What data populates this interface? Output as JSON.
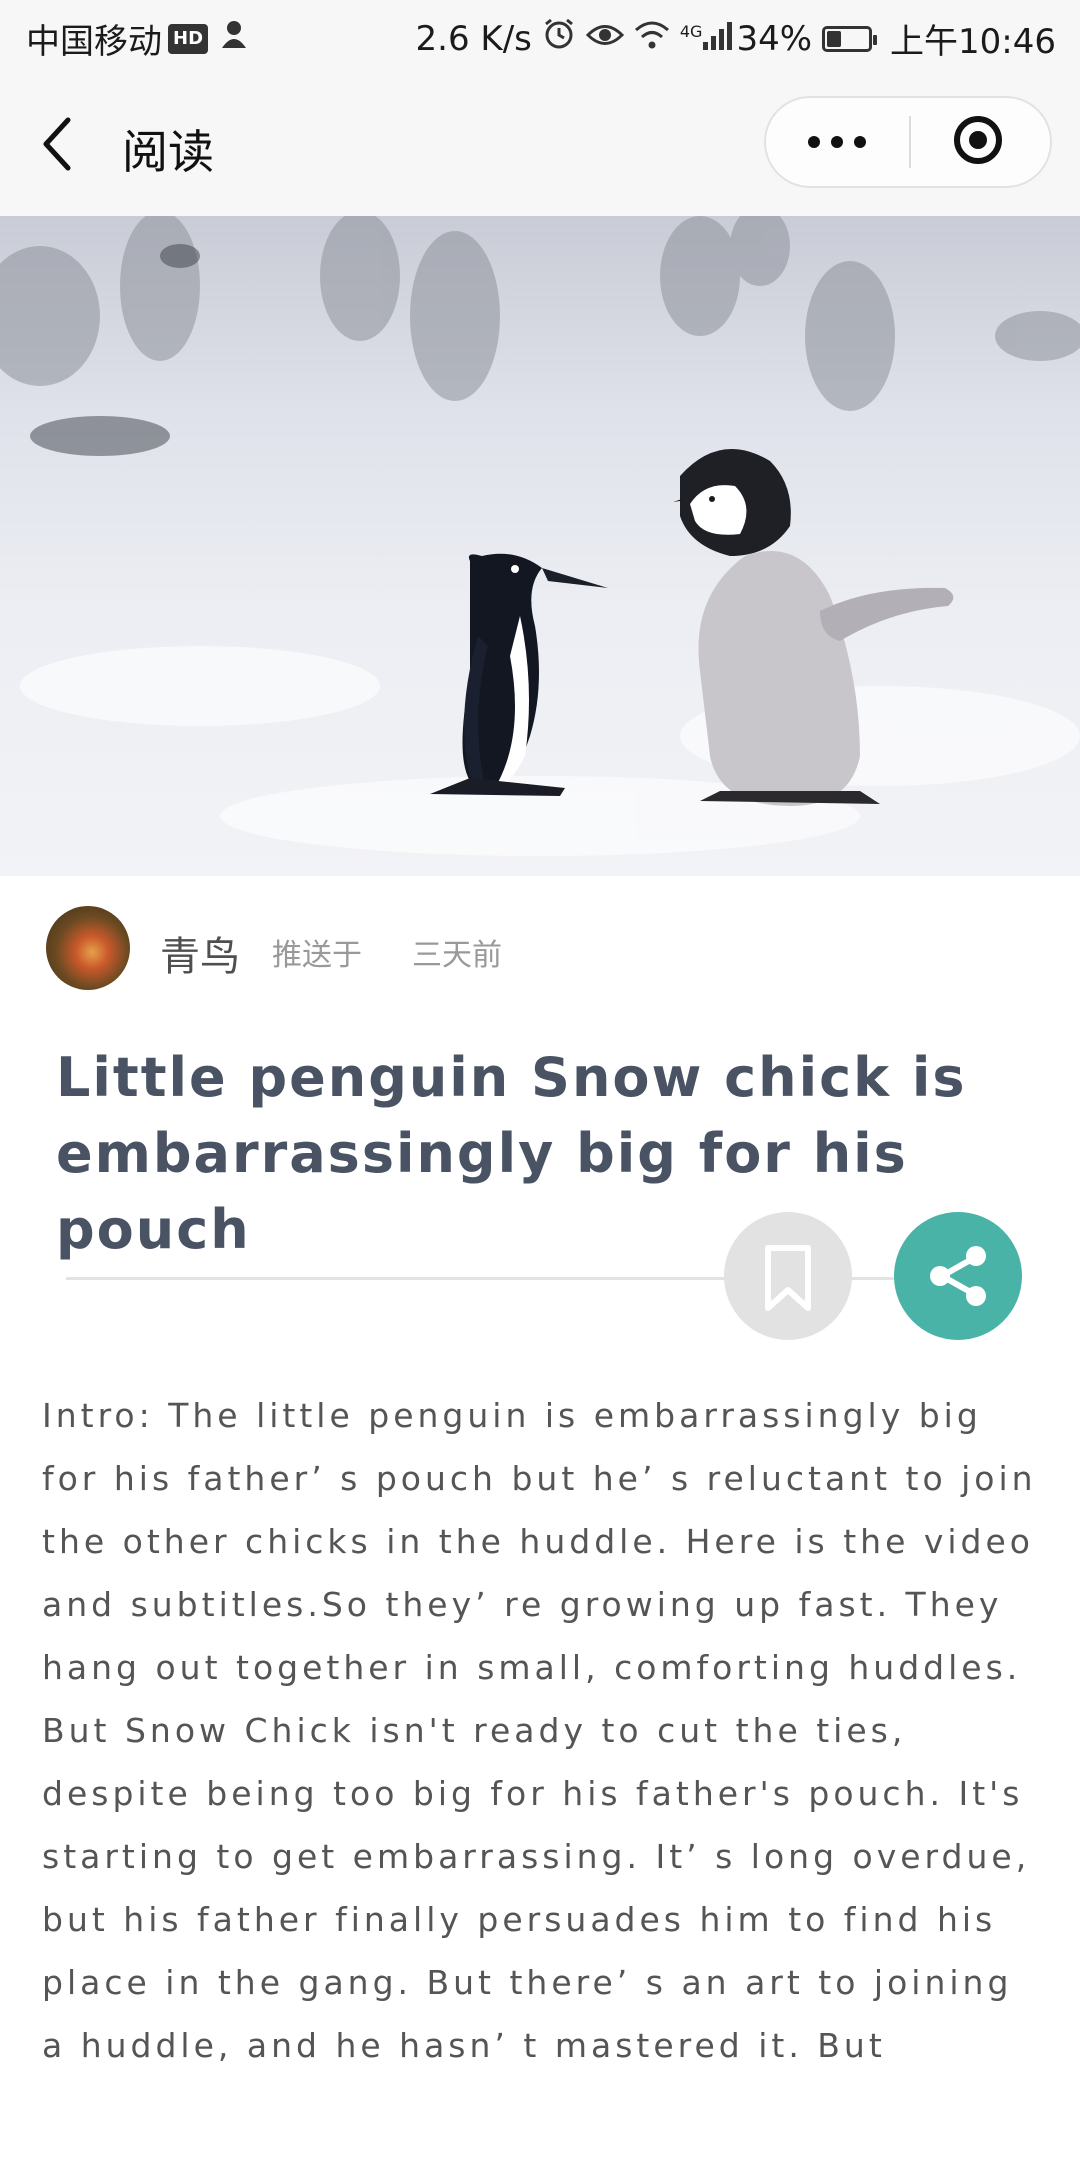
{
  "status_bar": {
    "carrier": "中国移动",
    "hd_badge": "HD",
    "speed": "2.6 K/s",
    "network": "4G",
    "battery": "34%",
    "battery_level": 0.34,
    "time": "上午10:46",
    "icons": [
      "profile-icon",
      "alarm-icon",
      "eye-icon",
      "wifi-icon",
      "signal-icon",
      "battery-icon"
    ]
  },
  "nav": {
    "title": "阅读",
    "icons": [
      "back-arrow-icon",
      "more-dots-icon",
      "close-target-icon"
    ]
  },
  "hero": {
    "icon": "penguins-photo"
  },
  "article": {
    "author": "青鸟",
    "pushed_label": "推送于",
    "time_ago": "三天前",
    "title": "Little penguin Snow chick is embarrassingly big for his pouch",
    "intro": "Intro: The little penguin is embarrassingly big for his father’ s pouch but he’ s reluctant to join the other chicks in the huddle. Here is the video and subtitles.So they’ re growing up fast. They hang out together in small, comforting huddles. But Snow Chick isn't ready to cut the ties, despite being too big for his father's pouch. It's starting to get embarrassing. It’ s long overdue, but his father finally persuades him to find his place in the gang. But there’ s an art to joining a huddle, and he hasn’ t mastered it. But"
  },
  "actions": {
    "bookmark_color": "#e2e2e2",
    "share_color": "#49b3a8",
    "icons": [
      "bookmark-icon",
      "share-icon"
    ]
  },
  "colors": {
    "title": "#4a5363",
    "body": "#555555",
    "accent": "#49b3a8"
  }
}
